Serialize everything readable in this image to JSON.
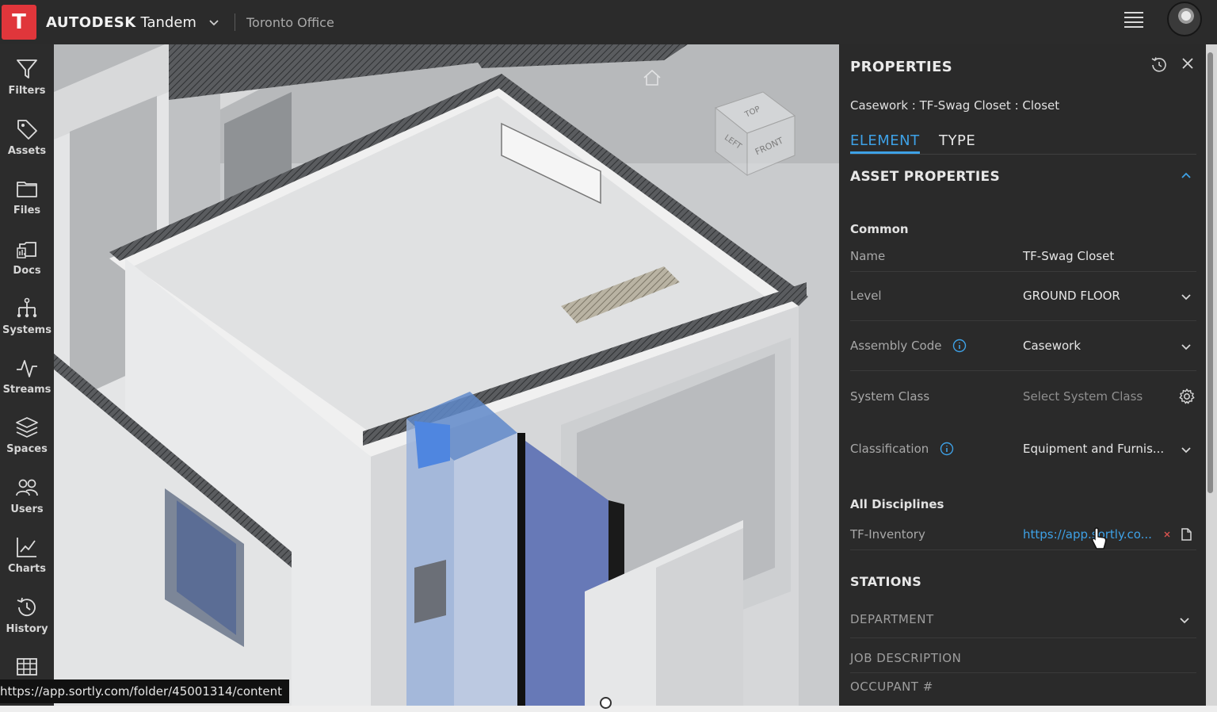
{
  "app": {
    "logo_letter": "T",
    "brand_bold": "AUTODESK",
    "brand_product": "Tandem",
    "project_name": "Toronto Office"
  },
  "sidebar": {
    "items": [
      {
        "label": "Filters",
        "icon": "filter-icon"
      },
      {
        "label": "Assets",
        "icon": "tag-icon"
      },
      {
        "label": "Files",
        "icon": "folder-icon"
      },
      {
        "label": "Docs",
        "icon": "docs-icon"
      },
      {
        "label": "Systems",
        "icon": "hierarchy-icon"
      },
      {
        "label": "Streams",
        "icon": "pulse-icon"
      },
      {
        "label": "Spaces",
        "icon": "layers-icon"
      },
      {
        "label": "Users",
        "icon": "users-icon"
      },
      {
        "label": "Charts",
        "icon": "chart-icon"
      },
      {
        "label": "History",
        "icon": "history-icon"
      },
      {
        "label": "",
        "icon": "table-icon"
      }
    ]
  },
  "viewport": {
    "viewcube_faces": [
      "TOP",
      "LEFT",
      "FRONT"
    ],
    "status_url": "https://app.sortly.com/folder/45001314/content"
  },
  "properties": {
    "title": "PROPERTIES",
    "subtitle": "Casework : TF-Swag Closet : Closet",
    "tabs": [
      {
        "label": "ELEMENT",
        "active": true
      },
      {
        "label": "TYPE",
        "active": false
      }
    ],
    "section_title": "ASSET PROPERTIES",
    "groups": {
      "common": "Common",
      "all_disciplines": "All Disciplines",
      "stations": "STATIONS"
    },
    "rows": {
      "name": {
        "label": "Name",
        "value": "TF-Swag Closet"
      },
      "level": {
        "label": "Level",
        "value": "GROUND FLOOR"
      },
      "assembly_code": {
        "label": "Assembly Code",
        "value": "Casework"
      },
      "system_class": {
        "label": "System Class",
        "placeholder": "Select System Class"
      },
      "classification": {
        "label": "Classification",
        "value": "Equipment and Furnis..."
      },
      "tf_inventory": {
        "label": "TF-Inventory",
        "value": "https://app.sortly.co..."
      }
    },
    "station_fields": [
      "DEPARTMENT",
      "JOB DESCRIPTION",
      "OCCUPANT #"
    ],
    "colors": {
      "accent": "#3ea1e6",
      "brand": "#e0363b",
      "panel_bg": "#2a2a2a"
    }
  }
}
